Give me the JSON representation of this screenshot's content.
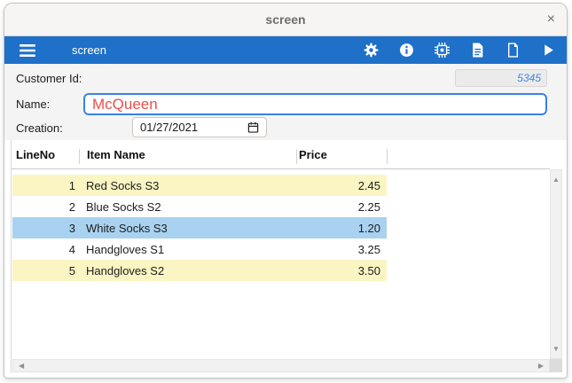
{
  "window": {
    "title": "screen",
    "close": "×"
  },
  "toolbar": {
    "title": "screen",
    "icons": [
      "menu",
      "settings",
      "info",
      "debug-chip",
      "document-text",
      "document-new",
      "run"
    ]
  },
  "form": {
    "customer_id": {
      "label": "Customer Id:",
      "value": "5345"
    },
    "name": {
      "label": "Name:",
      "value": "McQueen"
    },
    "creation": {
      "label": "Creation:",
      "value": "01/27/2021"
    }
  },
  "table": {
    "columns": [
      "LineNo",
      "Item Name",
      "Price"
    ],
    "rows": [
      {
        "line_no": "1",
        "item_name": "Red Socks S3",
        "price": "2.45",
        "highlight": "yellow"
      },
      {
        "line_no": "2",
        "item_name": "Blue Socks S2",
        "price": "2.25",
        "highlight": "none"
      },
      {
        "line_no": "3",
        "item_name": "White Socks S3",
        "price": "1.20",
        "highlight": "selected"
      },
      {
        "line_no": "4",
        "item_name": "Handgloves S1",
        "price": "3.25",
        "highlight": "none"
      },
      {
        "line_no": "5",
        "item_name": "Handgloves S2",
        "price": "3.50",
        "highlight": "yellow"
      }
    ]
  },
  "scrollbar": {
    "up": "▲",
    "down": "▼",
    "left": "◀",
    "right": "▶"
  },
  "colors": {
    "toolbar_blue": "#1e70c8",
    "focus_border_blue": "#3584e4",
    "name_text_red": "#e8504b",
    "customer_id_text_blue": "#3f87de",
    "row_yellow": "#fbf5c3",
    "row_selected_blue": "#a8d2f0"
  }
}
